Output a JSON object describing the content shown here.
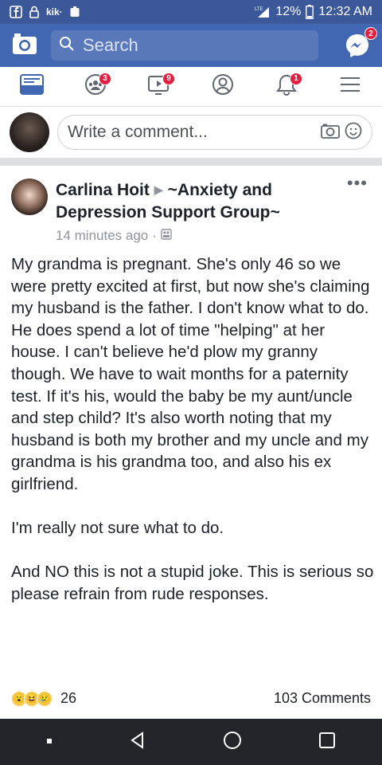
{
  "status_bar": {
    "app_icons": [
      "facebook-icon",
      "lock-icon",
      "kik-icon",
      "shield-icon"
    ],
    "kik_label": "kik·",
    "network": "LTE",
    "battery": "12%",
    "time": "12:32 AM"
  },
  "topbar": {
    "search_placeholder": "Search",
    "messenger_badge": "2"
  },
  "nav": {
    "items": [
      {
        "name": "news-feed",
        "icon": "news-feed-icon",
        "badge": ""
      },
      {
        "name": "groups",
        "icon": "groups-icon",
        "badge": "3"
      },
      {
        "name": "watch",
        "icon": "watch-icon",
        "badge": "9"
      },
      {
        "name": "profile",
        "icon": "profile-icon",
        "badge": ""
      },
      {
        "name": "notifications",
        "icon": "bell-icon",
        "badge": "1"
      },
      {
        "name": "menu",
        "icon": "menu-icon",
        "badge": ""
      }
    ]
  },
  "comment": {
    "placeholder": "Write a comment..."
  },
  "post": {
    "author": "Carlina Hoit",
    "group": "~Anxiety and Depression Support Group~",
    "time": "14 minutes ago",
    "paragraphs": [
      "My grandma is pregnant. She's only 46 so we were pretty excited at first, but now she's claiming my husband is the father. I don't know what to do. He does spend a lot of time \"helping\" at her house. I can't believe he'd plow my granny though. We have to wait months for a paternity test. If it's his, would the baby be my aunt/uncle and step child? It's also worth noting that my husband is both my brother and my uncle and my grandma is his grandma too, and also his ex girlfriend.",
      "I'm really not sure what to do.",
      "And NO this is not a stupid joke. This is serious so please refrain from rude responses."
    ],
    "reaction_count": "26",
    "comments_count": "103 Comments"
  },
  "colors": {
    "facebook_blue": "#4267b2",
    "status_blue": "#3b5998",
    "badge_red": "#e41e3f",
    "nav_dark": "#222529"
  }
}
